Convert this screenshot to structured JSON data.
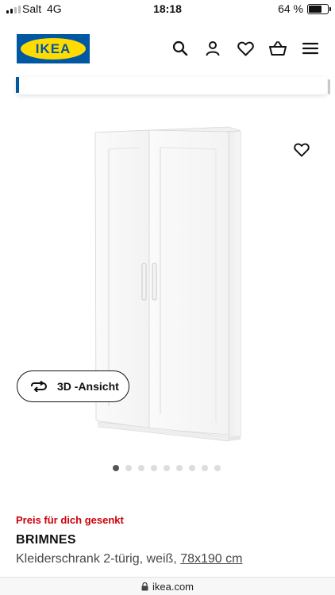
{
  "status_bar": {
    "carrier": "Salt",
    "network": "4G",
    "time": "18:18",
    "battery_percent": "64 %",
    "battery_level": 0.64
  },
  "header": {
    "logo_text": "IKEA",
    "icons": [
      "search-icon",
      "user-icon",
      "heart-icon",
      "basket-icon",
      "menu-icon"
    ]
  },
  "product": {
    "view_3d_label": "3D -Ansicht",
    "gallery": {
      "total": 9,
      "active_index": 0
    },
    "promo_label": "Preis für dich gesenkt",
    "name": "BRIMNES",
    "description": "Kleiderschrank 2-türig, weiß,",
    "dimensions": "78x190 cm"
  },
  "browser": {
    "url": "ikea.com"
  },
  "colors": {
    "ikea_blue": "#0058a3",
    "ikea_yellow": "#ffdb00",
    "promo_red": "#cc0008"
  }
}
